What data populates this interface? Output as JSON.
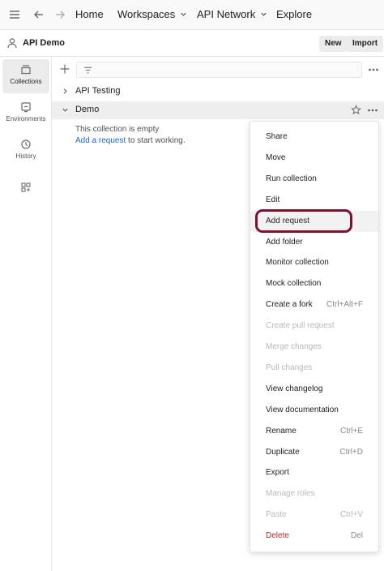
{
  "topbar": {
    "nav": [
      {
        "label": "Home",
        "dropdown": false
      },
      {
        "label": "Workspaces",
        "dropdown": true
      },
      {
        "label": "API Network",
        "dropdown": true
      },
      {
        "label": "Explore",
        "dropdown": false
      }
    ]
  },
  "workspace": {
    "title": "API Demo",
    "new_label": "New",
    "import_label": "Import"
  },
  "rail": {
    "items": [
      {
        "label": "Collections",
        "icon": "collections-icon",
        "active": true
      },
      {
        "label": "Environments",
        "icon": "environments-icon",
        "active": false
      },
      {
        "label": "History",
        "icon": "history-icon",
        "active": false
      },
      {
        "label": "",
        "icon": "apps-icon",
        "active": false
      }
    ]
  },
  "tree": {
    "collections": [
      {
        "name": "API Testing",
        "expanded": false
      },
      {
        "name": "Demo",
        "expanded": true
      }
    ],
    "empty_line1": "This collection is empty",
    "empty_link": "Add a request",
    "empty_rest": " to start working."
  },
  "context_menu": {
    "items": [
      {
        "label": "Share",
        "shortcut": "",
        "state": "normal"
      },
      {
        "label": "Move",
        "shortcut": "",
        "state": "normal"
      },
      {
        "label": "Run collection",
        "shortcut": "",
        "state": "normal"
      },
      {
        "label": "Edit",
        "shortcut": "",
        "state": "normal"
      },
      {
        "label": "Add request",
        "shortcut": "",
        "state": "highlight"
      },
      {
        "label": "Add folder",
        "shortcut": "",
        "state": "normal"
      },
      {
        "label": "Monitor collection",
        "shortcut": "",
        "state": "normal"
      },
      {
        "label": "Mock collection",
        "shortcut": "",
        "state": "normal"
      },
      {
        "label": "Create a fork",
        "shortcut": "Ctrl+Alt+F",
        "state": "normal"
      },
      {
        "label": "Create pull request",
        "shortcut": "",
        "state": "disabled"
      },
      {
        "label": "Merge changes",
        "shortcut": "",
        "state": "disabled"
      },
      {
        "label": "Pull changes",
        "shortcut": "",
        "state": "disabled"
      },
      {
        "label": "View changelog",
        "shortcut": "",
        "state": "normal"
      },
      {
        "label": "View documentation",
        "shortcut": "",
        "state": "normal"
      },
      {
        "label": "Rename",
        "shortcut": "Ctrl+E",
        "state": "normal"
      },
      {
        "label": "Duplicate",
        "shortcut": "Ctrl+D",
        "state": "normal"
      },
      {
        "label": "Export",
        "shortcut": "",
        "state": "normal"
      },
      {
        "label": "Manage roles",
        "shortcut": "",
        "state": "disabled"
      },
      {
        "label": "Paste",
        "shortcut": "Ctrl+V",
        "state": "disabled"
      },
      {
        "label": "Delete",
        "shortcut": "Del",
        "state": "danger"
      }
    ]
  },
  "colors": {
    "highlight_ring": "#7a1230",
    "link": "#1b67c8",
    "danger": "#b02b2b"
  }
}
